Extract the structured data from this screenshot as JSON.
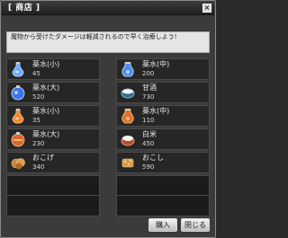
{
  "window": {
    "title": "[ 商店 ]",
    "close_glyph": "×"
  },
  "message": "魔物から受けたダメージは軽減されるので早く治療しよう!",
  "items": [
    {
      "name": "薬水(小)",
      "price": "45",
      "icon": "blue-potion-small-icon"
    },
    {
      "name": "薬水(中)",
      "price": "200",
      "icon": "blue-potion-medium-icon"
    },
    {
      "name": "薬水(大)",
      "price": "520",
      "icon": "blue-potion-large-icon"
    },
    {
      "name": "甘酒",
      "price": "730",
      "icon": "amazake-cup-icon"
    },
    {
      "name": "薬水(小)",
      "price": "35",
      "icon": "orange-potion-small-icon"
    },
    {
      "name": "薬水(中)",
      "price": "110",
      "icon": "orange-potion-medium-icon"
    },
    {
      "name": "薬水(大)",
      "price": "230",
      "icon": "orange-potion-large-icon"
    },
    {
      "name": "白米",
      "price": "450",
      "icon": "white-rice-icon"
    },
    {
      "name": "おこげ",
      "price": "340",
      "icon": "okoge-icon"
    },
    {
      "name": "おこし",
      "price": "590",
      "icon": "okoshi-icon"
    }
  ],
  "buttons": {
    "buy": "購入",
    "close": "閉じる"
  },
  "colors": {
    "window_bg": "#3b3b3b",
    "slot_bg": "#262626",
    "empty_slot_bg": "#1b1b1b",
    "message_bg": "#e5e5e5",
    "text": "#ededed"
  }
}
